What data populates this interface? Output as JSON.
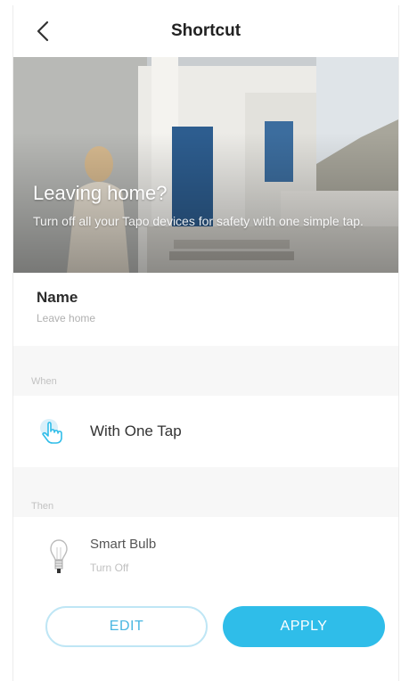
{
  "header": {
    "title": "Shortcut",
    "back_icon": "chevron-left-icon"
  },
  "hero": {
    "title": "Leaving home?",
    "subtitle": "Turn off all your Tapo devices for safety with one simple tap."
  },
  "name": {
    "label": "Name",
    "value": "Leave home"
  },
  "when": {
    "section_label": "When",
    "trigger": "With One Tap",
    "icon": "tap-hand-icon"
  },
  "then": {
    "section_label": "Then",
    "device_name": "Smart Bulb",
    "device_action": "Turn Off",
    "icon": "bulb-icon"
  },
  "buttons": {
    "edit": "EDIT",
    "apply": "APPLY"
  },
  "colors": {
    "accent": "#2fbde9",
    "accent_light": "#bfe6f5"
  }
}
